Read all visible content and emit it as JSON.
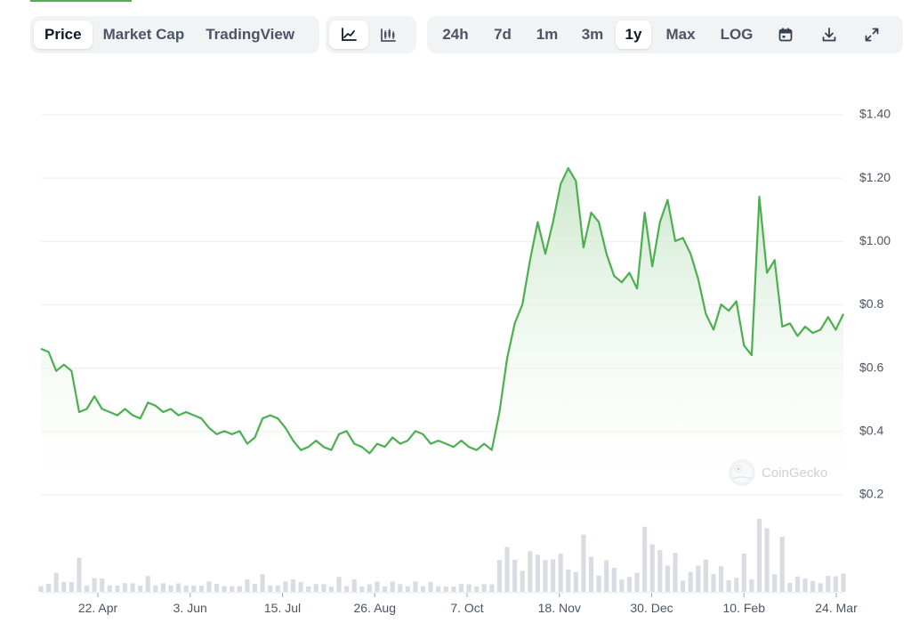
{
  "toolbar": {
    "data_type_tabs": [
      {
        "label": "Price",
        "active": true
      },
      {
        "label": "Market Cap",
        "active": false
      },
      {
        "label": "TradingView",
        "active": false
      }
    ],
    "chart_style_buttons": [
      {
        "icon": "line-chart-icon",
        "active": true
      },
      {
        "icon": "candlestick-chart-icon",
        "active": false
      }
    ],
    "ranges": [
      {
        "label": "24h",
        "active": false
      },
      {
        "label": "7d",
        "active": false
      },
      {
        "label": "1m",
        "active": false
      },
      {
        "label": "3m",
        "active": false
      },
      {
        "label": "1y",
        "active": true
      },
      {
        "label": "Max",
        "active": false
      },
      {
        "label": "LOG",
        "active": false
      }
    ],
    "action_icons": [
      "calendar-icon",
      "download-icon",
      "expand-icon"
    ]
  },
  "watermark": {
    "text": "CoinGecko"
  },
  "colors": {
    "line": "#4caf50",
    "area_top": "#c8e6c9",
    "grid": "#eceef1",
    "volume": "#d9dde3",
    "accent": "#4caf50"
  },
  "chart_data": {
    "type": "area",
    "y_axis": {
      "position": "right",
      "ticks": [
        "$0.2",
        "$0.4",
        "$0.6",
        "$0.8",
        "$1.00",
        "$1.20",
        "$1.40"
      ],
      "tick_values": [
        0.2,
        0.4,
        0.6,
        0.8,
        1.0,
        1.2,
        1.4
      ],
      "ylim": [
        0.2,
        1.4
      ]
    },
    "x_axis": {
      "ticks": [
        "22. Apr",
        "3. Jun",
        "15. Jul",
        "26. Aug",
        "7. Oct",
        "18. Nov",
        "30. Dec",
        "10. Feb",
        "24. Mar"
      ]
    },
    "grid": true,
    "series": [
      {
        "x": [
          "4 Apr",
          "8 Apr",
          "12 Apr",
          "16 Apr",
          "20 Apr",
          "22 Apr",
          "26 Apr",
          "30 Apr",
          "4 May",
          "8 May",
          "12 May",
          "16 May",
          "20 May",
          "24 May",
          "28 May",
          "3 Jun",
          "6 Jun",
          "10 Jun",
          "14 Jun",
          "18 Jun",
          "22 Jun",
          "26 Jun",
          "30 Jun",
          "4 Jul",
          "8 Jul",
          "12 Jul",
          "15 Jul",
          "18 Jul",
          "22 Jul",
          "26 Jul",
          "30 Jul",
          "3 Aug",
          "7 Aug",
          "11 Aug",
          "15 Aug",
          "19 Aug",
          "23 Aug",
          "26 Aug",
          "30 Aug",
          "3 Sep",
          "7 Sep",
          "11 Sep",
          "15 Sep",
          "19 Sep",
          "23 Sep",
          "27 Sep",
          "1 Oct",
          "4 Oct",
          "7 Oct",
          "11 Oct",
          "15 Oct",
          "19 Oct",
          "23 Oct",
          "27 Oct",
          "31 Oct",
          "4 Nov",
          "8 Nov",
          "12 Nov",
          "15 Nov",
          "18 Nov",
          "21 Nov",
          "24 Nov",
          "27 Nov",
          "30 Nov",
          "3 Dec",
          "6 Dec",
          "9 Dec",
          "12 Dec",
          "15 Dec",
          "18 Dec",
          "21 Dec",
          "24 Dec",
          "27 Dec",
          "30 Dec",
          "2 Jan",
          "5 Jan",
          "8 Jan",
          "11 Jan",
          "14 Jan",
          "17 Jan",
          "20 Jan",
          "23 Jan",
          "26 Jan",
          "29 Jan",
          "1 Feb",
          "4 Feb",
          "7 Feb",
          "10 Feb",
          "13 Feb",
          "16 Feb",
          "19 Feb",
          "21 Feb",
          "22 Feb",
          "23 Feb",
          "25 Feb",
          "28 Feb",
          "3 Mar",
          "6 Mar",
          "9 Mar",
          "12 Mar",
          "15 Mar",
          "18 Mar",
          "21 Mar",
          "24 Mar",
          "27 Mar",
          "30 Mar"
        ],
        "y": [
          0.65,
          0.64,
          0.58,
          0.6,
          0.58,
          0.45,
          0.46,
          0.5,
          0.46,
          0.45,
          0.44,
          0.46,
          0.44,
          0.43,
          0.48,
          0.47,
          0.45,
          0.46,
          0.44,
          0.45,
          0.44,
          0.43,
          0.4,
          0.38,
          0.39,
          0.38,
          0.39,
          0.35,
          0.37,
          0.43,
          0.44,
          0.43,
          0.4,
          0.36,
          0.33,
          0.34,
          0.36,
          0.34,
          0.33,
          0.38,
          0.39,
          0.35,
          0.34,
          0.32,
          0.35,
          0.34,
          0.37,
          0.35,
          0.36,
          0.39,
          0.38,
          0.35,
          0.36,
          0.35,
          0.34,
          0.36,
          0.34,
          0.33,
          0.35,
          0.33,
          0.45,
          0.62,
          0.73,
          0.79,
          0.93,
          1.05,
          0.95,
          1.05,
          1.17,
          1.22,
          1.18,
          0.97,
          1.08,
          1.05,
          0.95,
          0.88,
          0.86,
          0.89,
          0.84,
          1.08,
          0.91,
          1.05,
          1.12,
          0.99,
          1.0,
          0.95,
          0.87,
          0.76,
          0.71,
          0.79,
          0.77,
          0.8,
          0.66,
          0.63,
          1.13,
          0.89,
          0.93,
          0.72,
          0.73,
          0.69,
          0.72,
          0.7,
          0.71,
          0.75,
          0.71,
          0.76
        ]
      }
    ]
  }
}
